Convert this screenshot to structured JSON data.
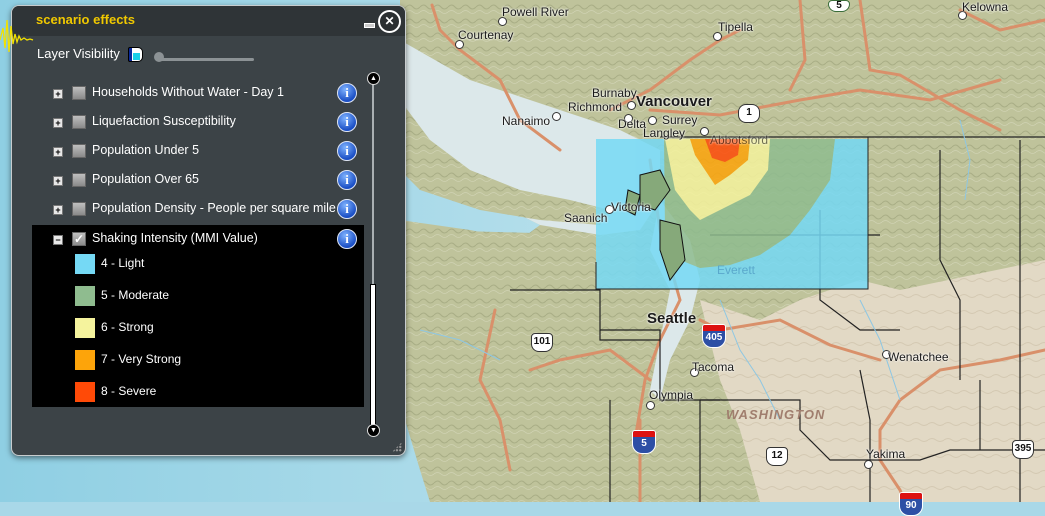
{
  "panel": {
    "title": "scenario effects",
    "layer_visibility_label": "Layer Visibility",
    "layer_visibility_value": 0,
    "layers": [
      {
        "label": "Households Without Water - Day 1",
        "checked": false,
        "expanded": false
      },
      {
        "label": "Liquefaction Susceptibility",
        "checked": false,
        "expanded": false
      },
      {
        "label": "Population Under 5",
        "checked": false,
        "expanded": false
      },
      {
        "label": "Population Over 65",
        "checked": false,
        "expanded": false
      },
      {
        "label": "Population Density - People per square mile",
        "checked": false,
        "expanded": false
      },
      {
        "label": "Shaking Intensity (MMI Value)",
        "checked": true,
        "expanded": true
      }
    ],
    "legend": [
      {
        "label": "4 - Light",
        "color": "#75d9f5"
      },
      {
        "label": "5 - Moderate",
        "color": "#8fbc8f"
      },
      {
        "label": "6 - Strong",
        "color": "#f5f39d"
      },
      {
        "label": "7 - Very Strong",
        "color": "#fda40a"
      },
      {
        "label": "8 - Severe",
        "color": "#ff4a07"
      }
    ],
    "expander_collapsed": "+",
    "expander_expanded": "−",
    "check_mark": "✓",
    "info_glyph": "i",
    "close_glyph": "✕",
    "scroll_up_glyph": "▲",
    "scroll_down_glyph": "▼"
  },
  "map": {
    "places": {
      "powell_river": "Powell River",
      "courtenay": "Courtenay",
      "tipella": "Tipella",
      "kelowna": "Kelowna",
      "burnaby": "Burnaby",
      "vancouver": "Vancouver",
      "richmond": "Richmond",
      "nanaimo": "Nanaimo",
      "delta": "Delta",
      "surrey": "Surrey",
      "langley": "Langley",
      "abbotsford": "Abbotsford",
      "saanich": "Saanich",
      "victoria": "Victoria",
      "everett": "Everett",
      "seattle": "Seattle",
      "tacoma": "Tacoma",
      "olympia": "Olympia",
      "wenatchee": "Wenatchee",
      "yakima": "Yakima",
      "washington": "WASHINGTON"
    },
    "shields": {
      "us101": "101",
      "us12": "12",
      "us395": "395",
      "bc1": "1",
      "bc5": "5",
      "i405": "405",
      "i5": "5",
      "i90": "90"
    }
  }
}
